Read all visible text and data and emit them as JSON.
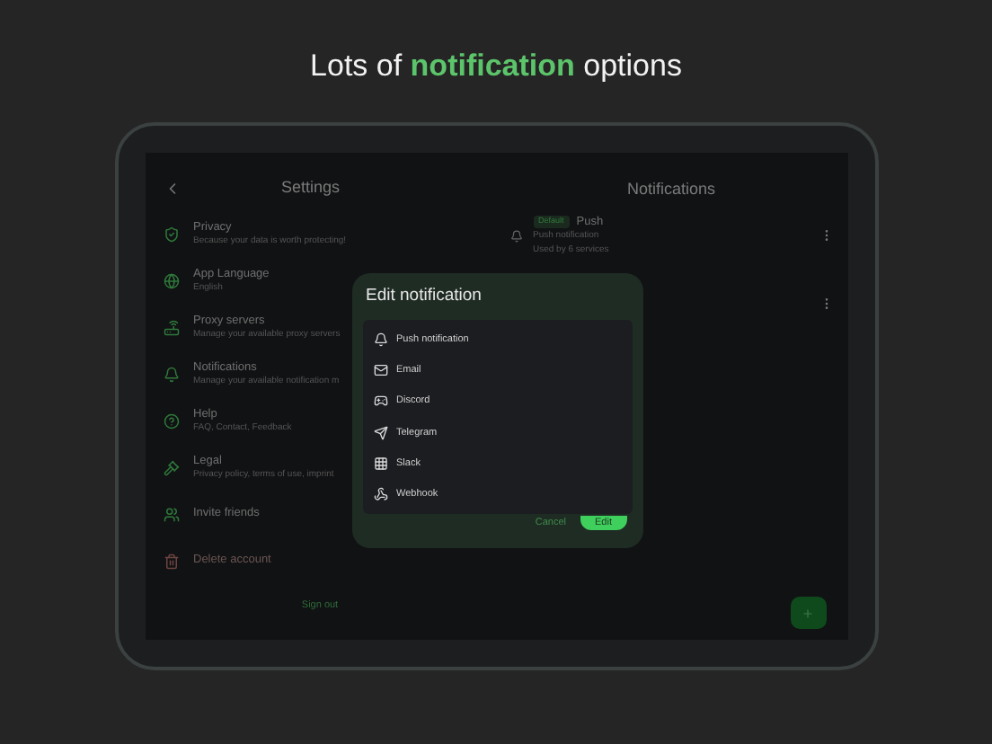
{
  "headline": [
    {
      "text": "Lots of ",
      "highlight": false
    },
    {
      "text": "notification",
      "highlight": true
    },
    {
      "text": " options",
      "highlight": false
    }
  ],
  "settings": {
    "title": "Settings",
    "items": [
      {
        "kind": "privacy",
        "title": "Privacy",
        "subtitle": "Because your data is worth protecting!"
      },
      {
        "kind": "language",
        "title": "App Language",
        "subtitle": "English"
      },
      {
        "kind": "proxy",
        "title": "Proxy servers",
        "subtitle": "Manage your available proxy servers"
      },
      {
        "kind": "notifications",
        "title": "Notifications",
        "subtitle": "Manage your available notification m"
      },
      {
        "kind": "help",
        "title": "Help",
        "subtitle": "FAQ, Contact, Feedback"
      },
      {
        "kind": "legal",
        "title": "Legal",
        "subtitle": "Privacy policy, terms of use, imprint"
      },
      {
        "kind": "invite",
        "title": "Invite friends"
      },
      {
        "kind": "delete",
        "title": "Delete account"
      }
    ],
    "sign_out": "Sign out"
  },
  "notifications": {
    "title": "Notifications",
    "items": [
      {
        "kind": "full",
        "badge": "Default",
        "title": "Push",
        "subtitle": "Push notification",
        "detail": "Used by 6 services"
      },
      {
        "kind": "covered"
      }
    ]
  },
  "dialog": {
    "title": "Edit notification",
    "options": [
      {
        "kind": "push",
        "label": "Push notification"
      },
      {
        "kind": "email",
        "label": "Email"
      },
      {
        "kind": "discord",
        "label": "Discord"
      },
      {
        "kind": "telegram",
        "label": "Telegram"
      },
      {
        "kind": "slack",
        "label": "Slack"
      },
      {
        "kind": "webhook",
        "label": "Webhook"
      }
    ],
    "buttons": [
      "Cancel",
      "Edit"
    ]
  }
}
